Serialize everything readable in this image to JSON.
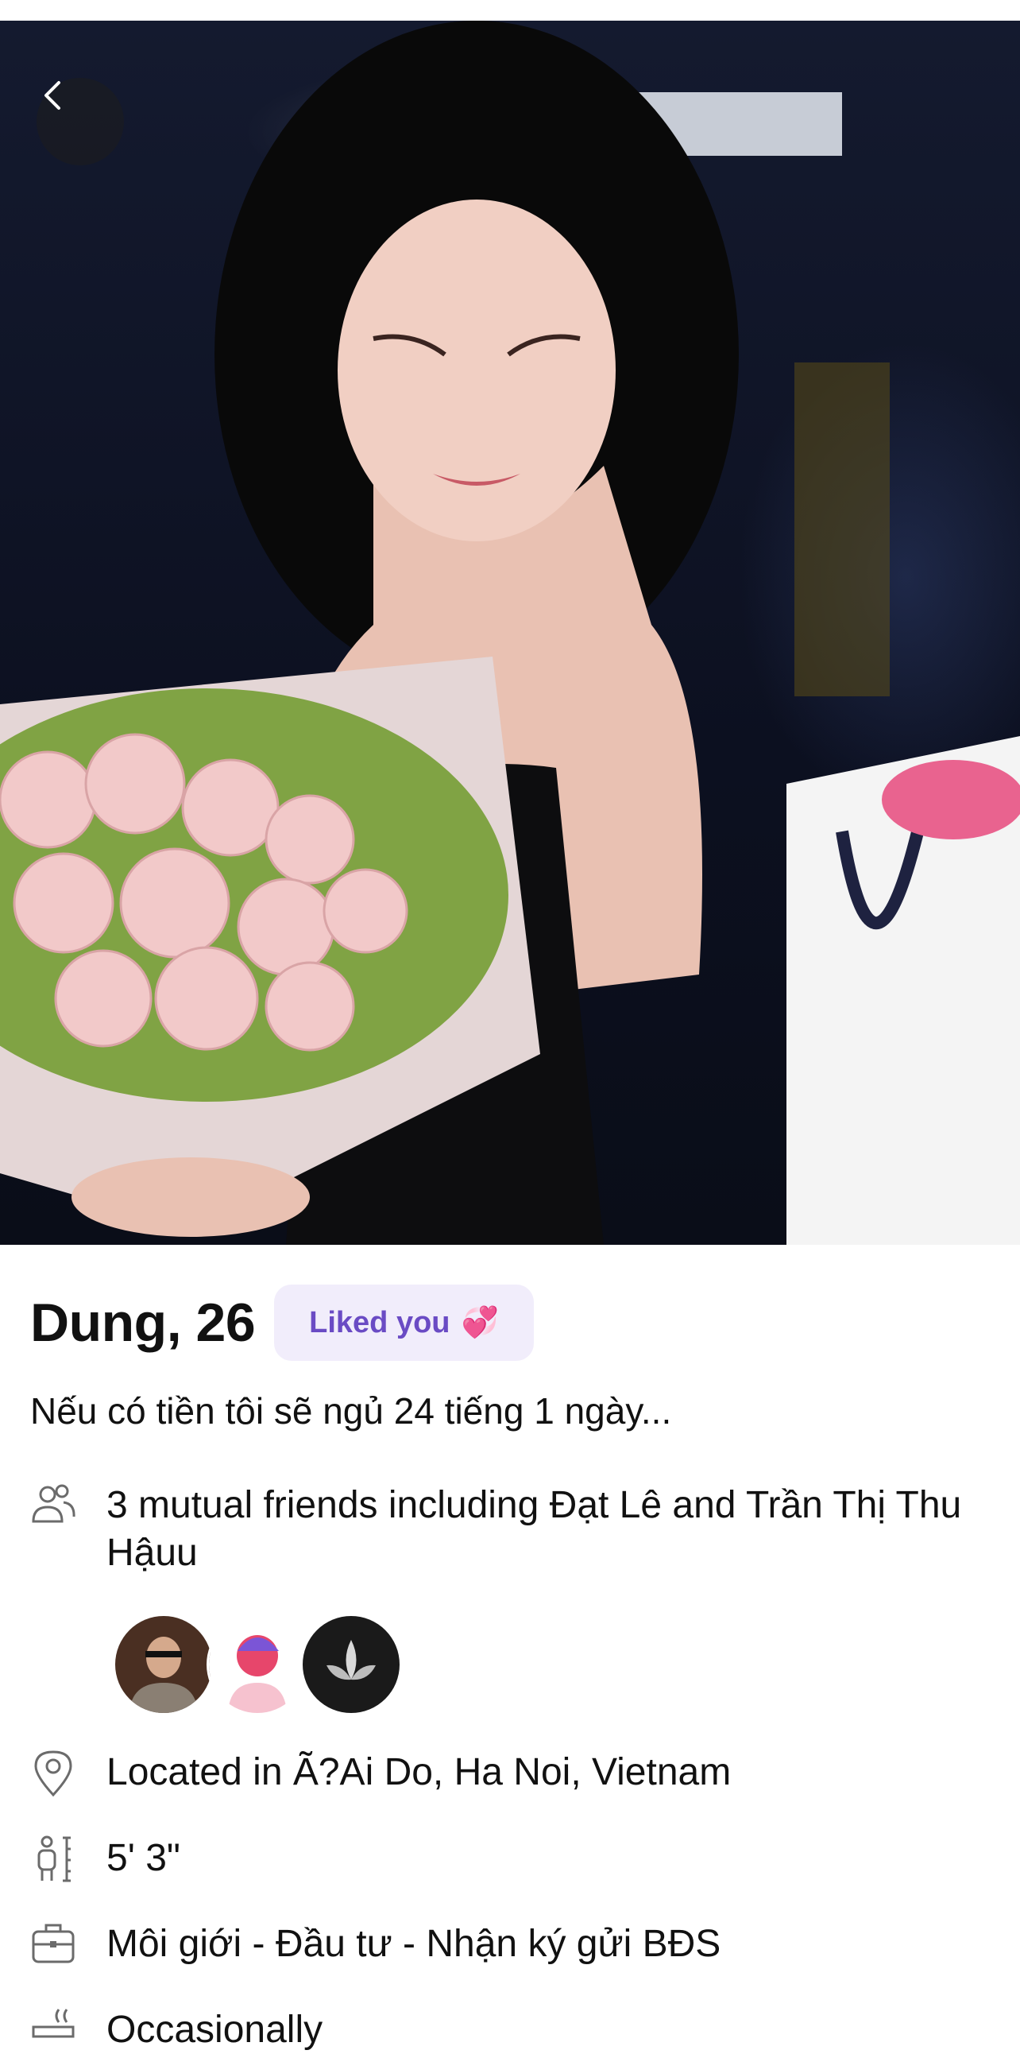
{
  "nav": {
    "back_icon": "chevron-left-icon"
  },
  "profile": {
    "name_age": "Dung, 26",
    "liked_badge": "Liked you",
    "liked_emoji": "💞",
    "bio": "Nếu có tiền tôi sẽ ngủ 24 tiếng 1 ngày...",
    "mutual_friends": "3 mutual friends including Đạt Lê and Trần Thị Thu Hậuu",
    "location": "Located in Ã?Ai Do, Ha Noi, Vietnam",
    "height": "5' 3\"",
    "work": "Môi giới - Đầu tư - Nhận ký gửi BĐS",
    "drinking": "Occasionally"
  },
  "icons": {
    "mutual": "people-icon",
    "location": "location-pin-icon",
    "height": "height-icon",
    "work": "briefcase-icon",
    "drinking": "drink-icon"
  },
  "colors": {
    "badge_bg": "#f1edfb",
    "badge_text": "#6a4bc4",
    "icon_gray": "#6b6b6b"
  }
}
